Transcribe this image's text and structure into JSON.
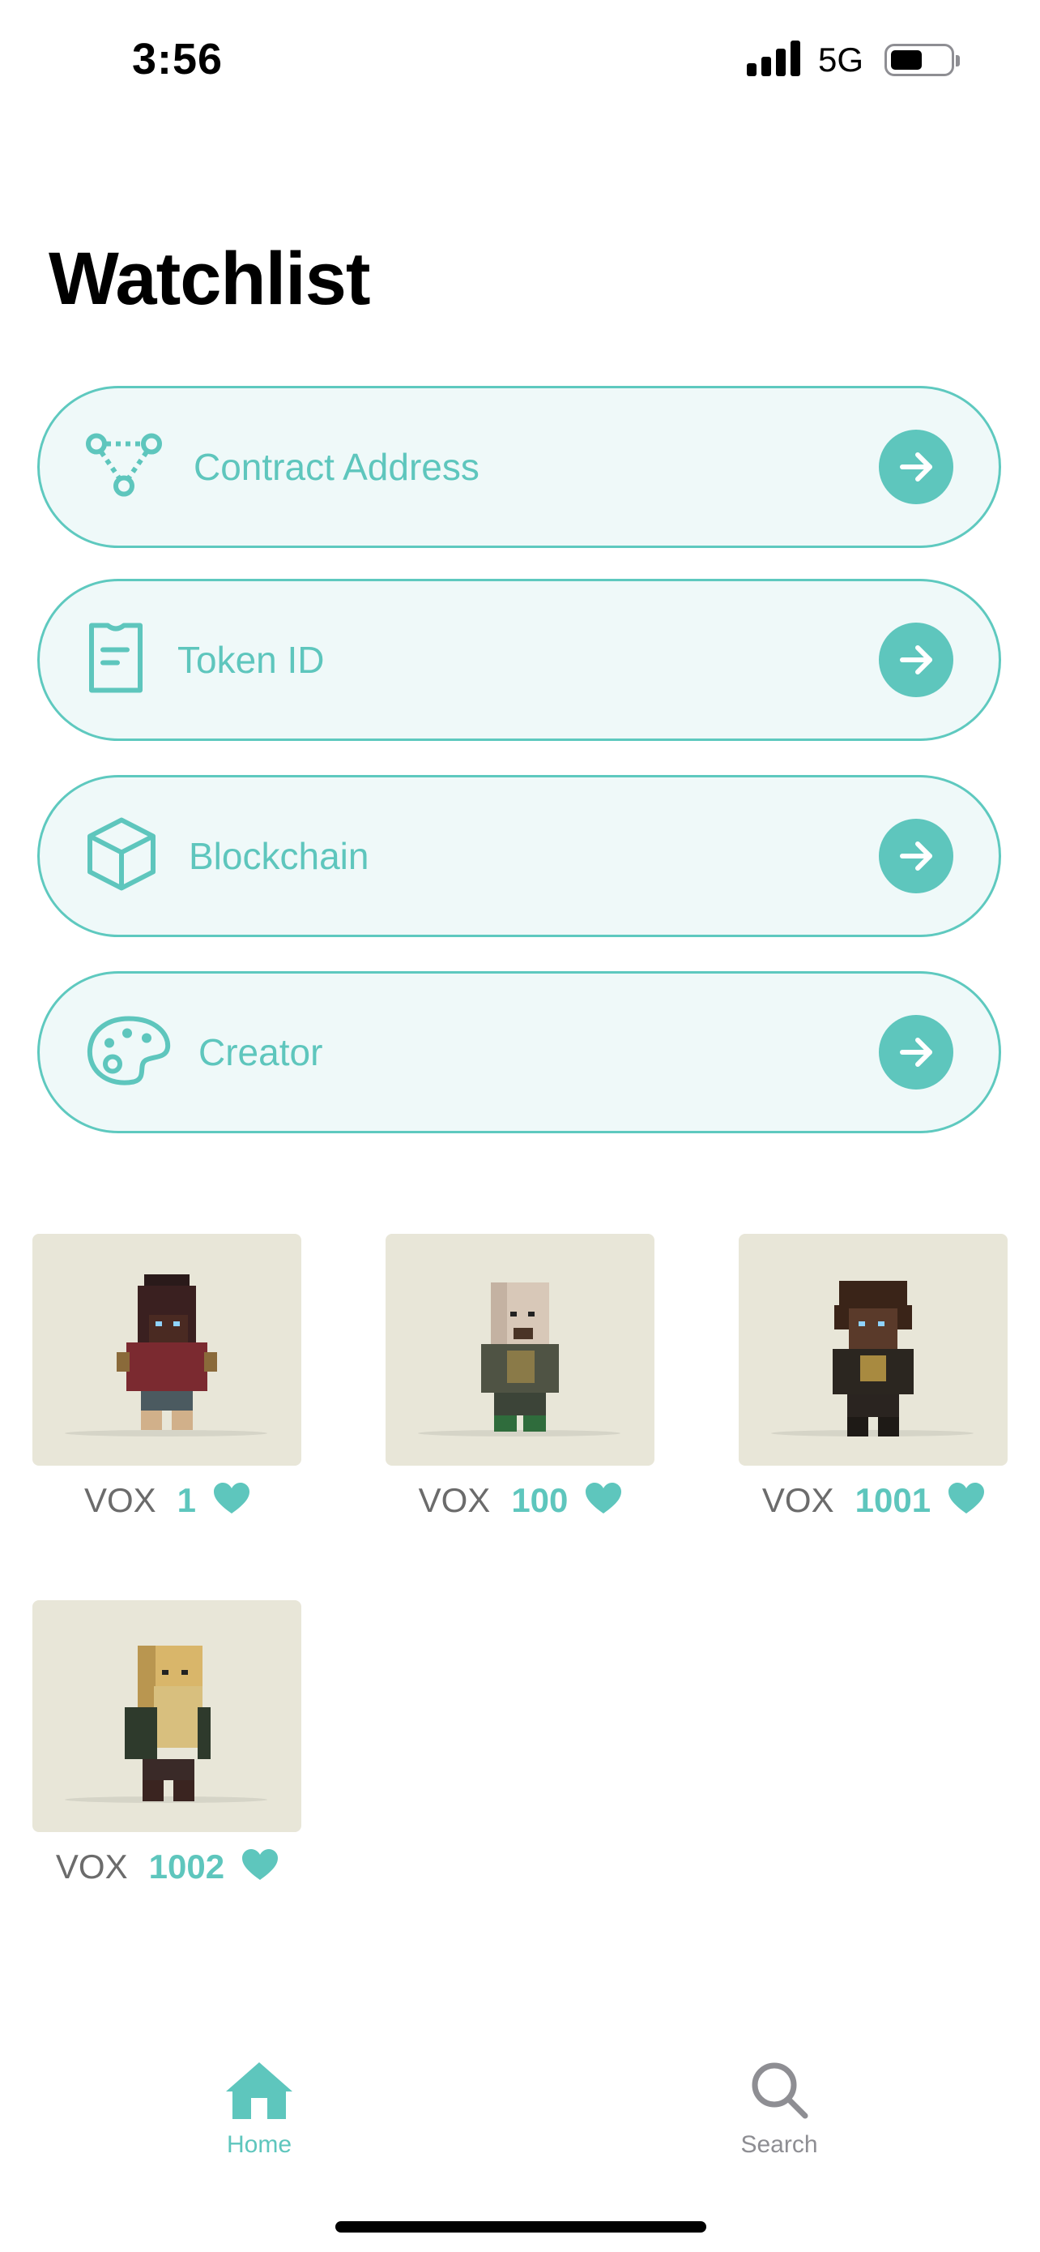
{
  "status_bar": {
    "time": "3:56",
    "network": "5G"
  },
  "header": {
    "title": "Watchlist"
  },
  "filters": [
    {
      "label": "Contract Address",
      "icon": "nodes-icon"
    },
    {
      "label": "Token ID",
      "icon": "clipboard-icon"
    },
    {
      "label": "Blockchain",
      "icon": "cube-icon"
    },
    {
      "label": "Creator",
      "icon": "palette-icon"
    }
  ],
  "items": [
    {
      "collection": "VOX",
      "number": "1"
    },
    {
      "collection": "VOX",
      "number": "100"
    },
    {
      "collection": "VOX",
      "number": "1001"
    },
    {
      "collection": "VOX",
      "number": "1002"
    }
  ],
  "tab_bar": {
    "home_label": "Home",
    "search_label": "Search"
  },
  "colors": {
    "accent": "#5ec6bd",
    "pill_bg": "#eff9f9",
    "card_bg": "#e8e6d8",
    "inactive": "#8e8e93"
  }
}
